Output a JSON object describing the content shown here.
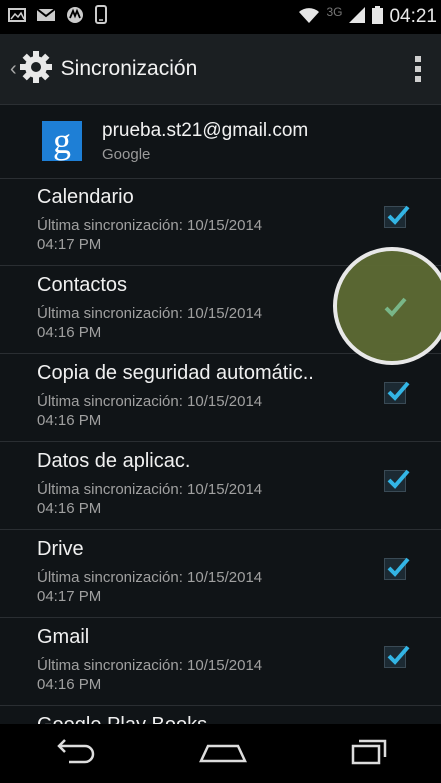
{
  "status_bar": {
    "icons_left": [
      "image-icon",
      "mail-icon",
      "motorola-icon",
      "phone-icon"
    ],
    "network_label": "3G",
    "time": "04:21"
  },
  "action_bar": {
    "title": "Sincronización",
    "icon": "gear-icon"
  },
  "account": {
    "email": "prueba.st21@gmail.com",
    "type": "Google",
    "badge_letter": "g",
    "badge_color": "#1e7fd6"
  },
  "sync_items": [
    {
      "name": "Calendario",
      "line1": "Última sincronización: 10/15/2014",
      "line2": "04:17 PM",
      "checked": true
    },
    {
      "name": "Contactos",
      "line1": "Última sincronización: 10/15/2014",
      "line2": "04:16 PM",
      "checked": true
    },
    {
      "name": "Copia de seguridad automátic..",
      "line1": "Última sincronización: 10/15/2014",
      "line2": "04:16 PM",
      "checked": true
    },
    {
      "name": "Datos de aplicac.",
      "line1": "Última sincronización: 10/15/2014",
      "line2": "04:16 PM",
      "checked": true
    },
    {
      "name": "Drive",
      "line1": "Última sincronización: 10/15/2014",
      "line2": "04:17 PM",
      "checked": true
    },
    {
      "name": "Gmail",
      "line1": "Última sincronización: 10/15/2014",
      "line2": "04:16 PM",
      "checked": true
    },
    {
      "name": "Google Play Books"
    }
  ],
  "colors": {
    "check_accent": "#33b5e5",
    "highlight": "#5d6b34"
  },
  "nav_bar": [
    "back-icon",
    "home-icon",
    "recents-icon"
  ]
}
